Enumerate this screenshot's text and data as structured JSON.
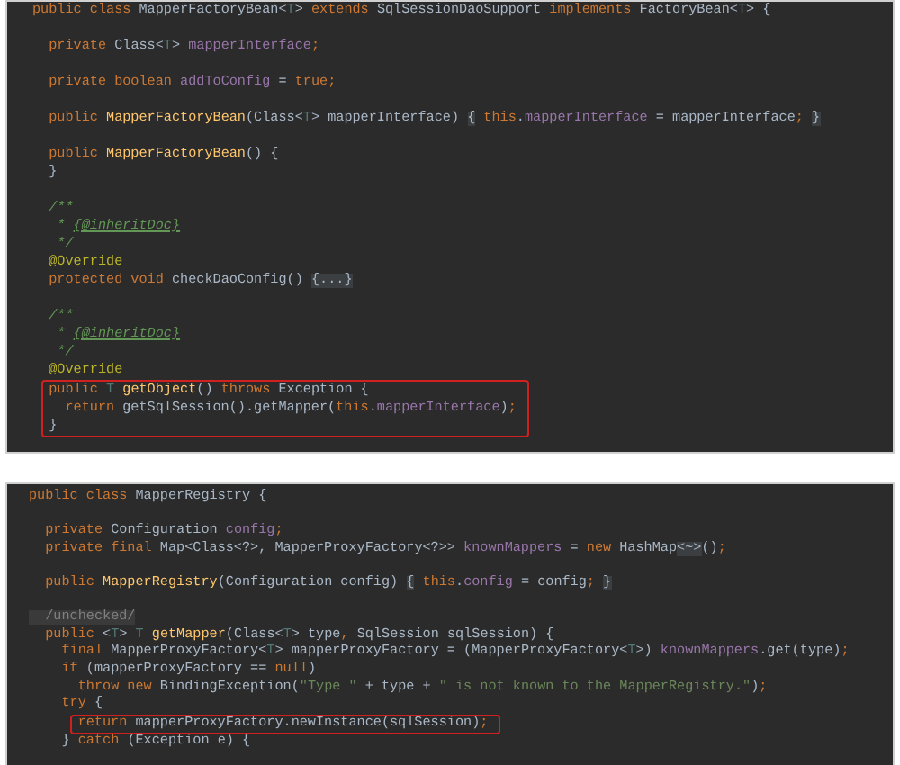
{
  "panels": [
    {
      "blocks": [
        [
          {
            "tokens": [
              {
                "kind": "kw",
                "text": "public class "
              },
              {
                "kind": "plain",
                "text": "MapperFactoryBean<"
              },
              {
                "kind": "generic",
                "text": "T"
              },
              {
                "kind": "plain",
                "text": "> "
              },
              {
                "kind": "kw",
                "text": "extends "
              },
              {
                "kind": "plain",
                "text": "SqlSessionDaoSupport "
              },
              {
                "kind": "kw",
                "text": "implements "
              },
              {
                "kind": "plain",
                "text": "FactoryBean<"
              },
              {
                "kind": "generic",
                "text": "T"
              },
              {
                "kind": "plain",
                "text": "> {"
              }
            ],
            "boxed": false
          }
        ],
        [
          {
            "tokens": [
              {
                "kind": "kw",
                "text": "  private "
              },
              {
                "kind": "plain",
                "text": "Class<"
              },
              {
                "kind": "generic",
                "text": "T"
              },
              {
                "kind": "plain",
                "text": "> "
              },
              {
                "kind": "field",
                "text": "mapperInterface"
              },
              {
                "kind": "kw",
                "text": ";"
              }
            ],
            "boxed": false
          }
        ],
        [
          {
            "tokens": [
              {
                "kind": "kw",
                "text": "  private boolean "
              },
              {
                "kind": "field",
                "text": "addToConfig"
              },
              {
                "kind": "plain",
                "text": " = "
              },
              {
                "kind": "kw",
                "text": "true;"
              }
            ],
            "boxed": false
          }
        ],
        [
          {
            "tokens": [
              {
                "kind": "kw",
                "text": "  public "
              },
              {
                "kind": "method",
                "text": "MapperFactoryBean"
              },
              {
                "kind": "plain",
                "text": "(Class<"
              },
              {
                "kind": "generic",
                "text": "T"
              },
              {
                "kind": "plain",
                "text": "> mapperInterface) "
              },
              {
                "kind": "fold",
                "text": "{"
              },
              {
                "kind": "kw",
                "text": " this"
              },
              {
                "kind": "plain",
                "text": "."
              },
              {
                "kind": "field",
                "text": "mapperInterface"
              },
              {
                "kind": "plain",
                "text": " = mapperInterface"
              },
              {
                "kind": "kw",
                "text": "; "
              },
              {
                "kind": "fold",
                "text": "}"
              }
            ],
            "boxed": false
          }
        ],
        [
          {
            "tokens": [
              {
                "kind": "kw",
                "text": "  public "
              },
              {
                "kind": "method",
                "text": "MapperFactoryBean"
              },
              {
                "kind": "plain",
                "text": "() {"
              }
            ],
            "boxed": false
          },
          {
            "tokens": [
              {
                "kind": "plain",
                "text": "  }"
              }
            ],
            "boxed": false
          }
        ],
        [
          {
            "tokens": [
              {
                "kind": "doc",
                "text": "  /**"
              }
            ],
            "boxed": false
          },
          {
            "tokens": [
              {
                "kind": "doc",
                "text": "   * "
              },
              {
                "kind": "doctag",
                "text": "{@inheritDoc}"
              }
            ],
            "boxed": false
          },
          {
            "tokens": [
              {
                "kind": "doc",
                "text": "   */"
              }
            ],
            "boxed": false
          },
          {
            "tokens": [
              {
                "kind": "annotation",
                "text": "  @Override"
              }
            ],
            "boxed": false
          },
          {
            "tokens": [
              {
                "kind": "kw",
                "text": "  protected void "
              },
              {
                "kind": "plain",
                "text": "checkDaoConfig() "
              },
              {
                "kind": "fold",
                "text": "{...}"
              }
            ],
            "boxed": false
          }
        ],
        [
          {
            "tokens": [
              {
                "kind": "doc",
                "text": "  /**"
              }
            ],
            "boxed": false
          },
          {
            "tokens": [
              {
                "kind": "doc",
                "text": "   * "
              },
              {
                "kind": "doctag",
                "text": "{@inheritDoc}"
              }
            ],
            "boxed": false
          },
          {
            "tokens": [
              {
                "kind": "doc",
                "text": "   */"
              }
            ],
            "boxed": false
          },
          {
            "tokens": [
              {
                "kind": "annotation",
                "text": "  @Override"
              }
            ],
            "boxed": false
          },
          {
            "tokens": [
              {
                "kind": "kw",
                "text": "  public "
              },
              {
                "kind": "generic",
                "text": "T"
              },
              {
                "kind": "method",
                "text": " getObject"
              },
              {
                "kind": "plain",
                "text": "() "
              },
              {
                "kind": "kw",
                "text": "throws "
              },
              {
                "kind": "plain",
                "text": "Exception {"
              }
            ],
            "boxed": true
          },
          {
            "tokens": [
              {
                "kind": "kw",
                "text": "    return "
              },
              {
                "kind": "plain",
                "text": "getSqlSession().getMapper("
              },
              {
                "kind": "kw",
                "text": "this"
              },
              {
                "kind": "plain",
                "text": "."
              },
              {
                "kind": "field",
                "text": "mapperInterface"
              },
              {
                "kind": "plain",
                "text": ")"
              },
              {
                "kind": "kw",
                "text": ";"
              }
            ],
            "boxed": true
          },
          {
            "tokens": [
              {
                "kind": "plain",
                "text": "  }"
              }
            ],
            "boxed": true
          }
        ]
      ]
    },
    {
      "blocks": [
        [
          {
            "tokens": [
              {
                "kind": "kw",
                "text": "public class "
              },
              {
                "kind": "plain",
                "text": "MapperRegistry {"
              }
            ],
            "boxed": false
          }
        ],
        [
          {
            "tokens": [
              {
                "kind": "kw",
                "text": "  private "
              },
              {
                "kind": "plain",
                "text": "Configuration "
              },
              {
                "kind": "field",
                "text": "config"
              },
              {
                "kind": "kw",
                "text": ";"
              }
            ],
            "boxed": false
          },
          {
            "tokens": [
              {
                "kind": "kw",
                "text": "  private final "
              },
              {
                "kind": "plain",
                "text": "Map<Class<?>, MapperProxyFactory<?>> "
              },
              {
                "kind": "field",
                "text": "knownMappers"
              },
              {
                "kind": "plain",
                "text": " = "
              },
              {
                "kind": "kw",
                "text": "new "
              },
              {
                "kind": "plain",
                "text": "HashMap"
              },
              {
                "kind": "fold",
                "text": "<~>"
              },
              {
                "kind": "plain",
                "text": "()"
              },
              {
                "kind": "kw",
                "text": ";"
              }
            ],
            "boxed": false
          }
        ],
        [
          {
            "tokens": [
              {
                "kind": "kw",
                "text": "  public "
              },
              {
                "kind": "method",
                "text": "MapperRegistry"
              },
              {
                "kind": "plain",
                "text": "(Configuration config) "
              },
              {
                "kind": "fold",
                "text": "{"
              },
              {
                "kind": "kw",
                "text": " this"
              },
              {
                "kind": "plain",
                "text": "."
              },
              {
                "kind": "field",
                "text": "config"
              },
              {
                "kind": "plain",
                "text": " = config"
              },
              {
                "kind": "kw",
                "text": "; "
              },
              {
                "kind": "fold",
                "text": "}"
              }
            ],
            "boxed": false
          }
        ],
        [
          {
            "tokens": [
              {
                "kind": "comment",
                "text": "  /unchecked/"
              }
            ],
            "boxed": false
          },
          {
            "tokens": [
              {
                "kind": "kw",
                "text": "  public "
              },
              {
                "kind": "plain",
                "text": "<"
              },
              {
                "kind": "generic",
                "text": "T"
              },
              {
                "kind": "plain",
                "text": "> "
              },
              {
                "kind": "generic",
                "text": "T"
              },
              {
                "kind": "method",
                "text": " getMapper"
              },
              {
                "kind": "plain",
                "text": "(Class<"
              },
              {
                "kind": "generic",
                "text": "T"
              },
              {
                "kind": "plain",
                "text": "> type"
              },
              {
                "kind": "kw",
                "text": ", "
              },
              {
                "kind": "plain",
                "text": "SqlSession sqlSession) {"
              }
            ],
            "boxed": false
          },
          {
            "tokens": [
              {
                "kind": "kw",
                "text": "    final "
              },
              {
                "kind": "plain",
                "text": "MapperProxyFactory<"
              },
              {
                "kind": "generic",
                "text": "T"
              },
              {
                "kind": "plain",
                "text": "> mapperProxyFactory = (MapperProxyFactory<"
              },
              {
                "kind": "generic",
                "text": "T"
              },
              {
                "kind": "plain",
                "text": ">) "
              },
              {
                "kind": "field",
                "text": "knownMappers"
              },
              {
                "kind": "plain",
                "text": ".get(type)"
              },
              {
                "kind": "kw",
                "text": ";"
              }
            ],
            "boxed": false
          },
          {
            "tokens": [
              {
                "kind": "kw",
                "text": "    if "
              },
              {
                "kind": "plain",
                "text": "(mapperProxyFactory == "
              },
              {
                "kind": "kw",
                "text": "null"
              },
              {
                "kind": "plain",
                "text": ")"
              }
            ],
            "boxed": false
          },
          {
            "tokens": [
              {
                "kind": "kw",
                "text": "      throw new "
              },
              {
                "kind": "plain",
                "text": "BindingException("
              },
              {
                "kind": "string",
                "text": "\"Type \""
              },
              {
                "kind": "plain",
                "text": " + type + "
              },
              {
                "kind": "string",
                "text": "\" is not known to the MapperRegistry.\""
              },
              {
                "kind": "plain",
                "text": ")"
              },
              {
                "kind": "kw",
                "text": ";"
              }
            ],
            "boxed": false
          },
          {
            "tokens": [
              {
                "kind": "kw",
                "text": "    try "
              },
              {
                "kind": "plain",
                "text": "{"
              }
            ],
            "boxed": false
          },
          {
            "tokens": [
              {
                "kind": "kw",
                "text": "      return "
              },
              {
                "kind": "plain",
                "text": "mapperProxyFactory.newInstance(sqlSession)"
              },
              {
                "kind": "kw",
                "text": ";"
              }
            ],
            "boxed": true
          },
          {
            "tokens": [
              {
                "kind": "plain",
                "text": "    } "
              },
              {
                "kind": "kw",
                "text": "catch "
              },
              {
                "kind": "plain",
                "text": "(Exception e) {"
              }
            ],
            "boxed": false
          }
        ]
      ]
    }
  ]
}
